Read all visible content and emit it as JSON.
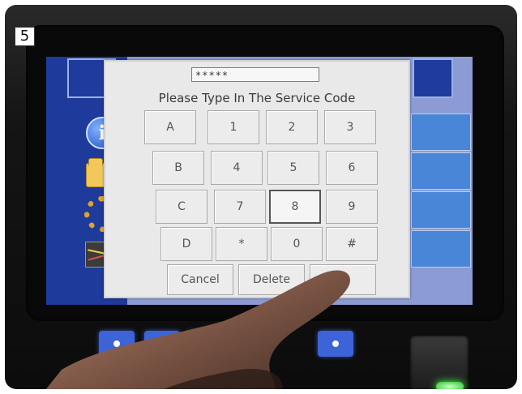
{
  "step_badge": "5",
  "dialog": {
    "code_value": "*****",
    "prompt": "Please Type In The Service Code",
    "keys": [
      {
        "label": "A"
      },
      {
        "label": "1"
      },
      {
        "label": "2"
      },
      {
        "label": "3"
      },
      {
        "label": "B"
      },
      {
        "label": "4"
      },
      {
        "label": "5"
      },
      {
        "label": "6"
      },
      {
        "label": "C"
      },
      {
        "label": "7"
      },
      {
        "label": "8"
      },
      {
        "label": "9"
      },
      {
        "label": "D"
      },
      {
        "label": "*"
      },
      {
        "label": "0"
      },
      {
        "label": "#"
      }
    ],
    "cancel_label": "Cancel",
    "delete_label": "Delete",
    "pressed_key": "8"
  },
  "sidebar_icons": [
    "info-icon",
    "folder-icon",
    "ring-icon",
    "chart-icon"
  ],
  "colors": {
    "screen_bg": "#8c9bd4",
    "sidebar_bg": "#1e3a9a",
    "dialog_bg": "#e9e9e9",
    "hardware_button": "#3d63d8",
    "status_led": "#26c42a"
  }
}
